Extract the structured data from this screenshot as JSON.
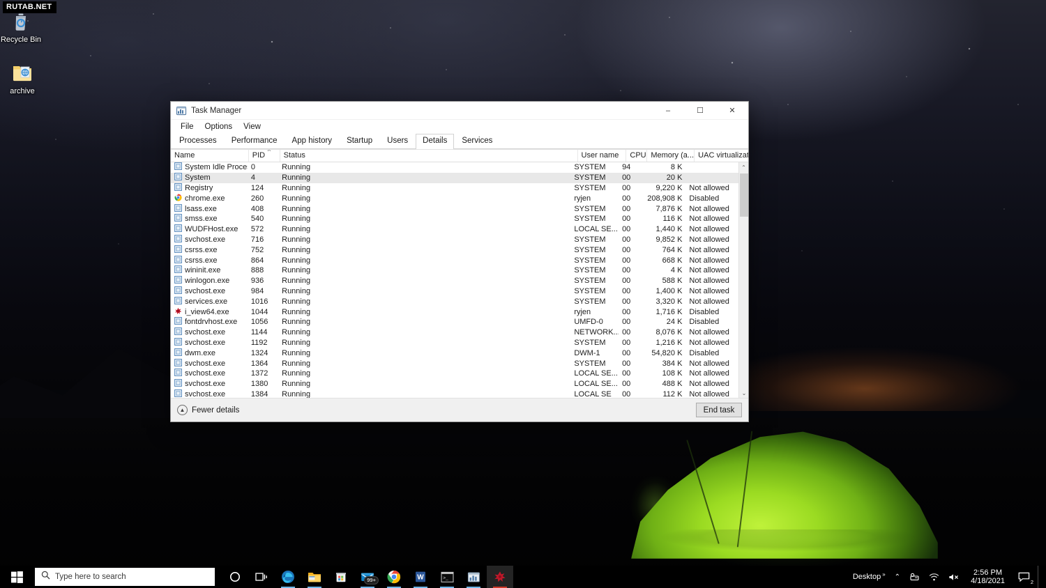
{
  "desktop": {
    "watermark": "RUTAB.NET",
    "icons": [
      {
        "label": "Recycle Bin",
        "icon": "recycle-bin-icon"
      },
      {
        "label": "archive",
        "icon": "folder-icon"
      }
    ]
  },
  "window": {
    "title": "Task Manager",
    "icon": "task-manager-icon",
    "controls": {
      "minimize": "‒",
      "maximize": "☐",
      "close": "✕"
    },
    "menu": [
      "File",
      "Options",
      "View"
    ],
    "tabs": [
      {
        "label": "Processes",
        "active": false
      },
      {
        "label": "Performance",
        "active": false
      },
      {
        "label": "App history",
        "active": false
      },
      {
        "label": "Startup",
        "active": false
      },
      {
        "label": "Users",
        "active": false
      },
      {
        "label": "Details",
        "active": true
      },
      {
        "label": "Services",
        "active": false
      }
    ],
    "columns": {
      "name": "Name",
      "pid": "PID",
      "status": "Status",
      "user": "User name",
      "cpu": "CPU",
      "memory": "Memory (a...",
      "uac": "UAC virtualizat...",
      "sort_indicator": "^"
    },
    "rows": [
      {
        "name": "System Idle Process",
        "pid": "0",
        "status": "Running",
        "user": "SYSTEM",
        "cpu": "94",
        "memory": "8 K",
        "uac": "",
        "icon": "process-icon",
        "selected": false
      },
      {
        "name": "System",
        "pid": "4",
        "status": "Running",
        "user": "SYSTEM",
        "cpu": "00",
        "memory": "20 K",
        "uac": "",
        "icon": "process-icon",
        "selected": true
      },
      {
        "name": "Registry",
        "pid": "124",
        "status": "Running",
        "user": "SYSTEM",
        "cpu": "00",
        "memory": "9,220 K",
        "uac": "Not allowed",
        "icon": "process-icon",
        "selected": false
      },
      {
        "name": "chrome.exe",
        "pid": "260",
        "status": "Running",
        "user": "ryjen",
        "cpu": "00",
        "memory": "208,908 K",
        "uac": "Disabled",
        "icon": "chrome-icon",
        "selected": false
      },
      {
        "name": "lsass.exe",
        "pid": "408",
        "status": "Running",
        "user": "SYSTEM",
        "cpu": "00",
        "memory": "7,876 K",
        "uac": "Not allowed",
        "icon": "process-icon",
        "selected": false
      },
      {
        "name": "smss.exe",
        "pid": "540",
        "status": "Running",
        "user": "SYSTEM",
        "cpu": "00",
        "memory": "116 K",
        "uac": "Not allowed",
        "icon": "process-icon",
        "selected": false
      },
      {
        "name": "WUDFHost.exe",
        "pid": "572",
        "status": "Running",
        "user": "LOCAL SE...",
        "cpu": "00",
        "memory": "1,440 K",
        "uac": "Not allowed",
        "icon": "process-icon",
        "selected": false
      },
      {
        "name": "svchost.exe",
        "pid": "716",
        "status": "Running",
        "user": "SYSTEM",
        "cpu": "00",
        "memory": "9,852 K",
        "uac": "Not allowed",
        "icon": "process-icon",
        "selected": false
      },
      {
        "name": "csrss.exe",
        "pid": "752",
        "status": "Running",
        "user": "SYSTEM",
        "cpu": "00",
        "memory": "764 K",
        "uac": "Not allowed",
        "icon": "process-icon",
        "selected": false
      },
      {
        "name": "csrss.exe",
        "pid": "864",
        "status": "Running",
        "user": "SYSTEM",
        "cpu": "00",
        "memory": "668 K",
        "uac": "Not allowed",
        "icon": "process-icon",
        "selected": false
      },
      {
        "name": "wininit.exe",
        "pid": "888",
        "status": "Running",
        "user": "SYSTEM",
        "cpu": "00",
        "memory": "4 K",
        "uac": "Not allowed",
        "icon": "process-icon",
        "selected": false
      },
      {
        "name": "winlogon.exe",
        "pid": "936",
        "status": "Running",
        "user": "SYSTEM",
        "cpu": "00",
        "memory": "588 K",
        "uac": "Not allowed",
        "icon": "process-icon",
        "selected": false
      },
      {
        "name": "svchost.exe",
        "pid": "984",
        "status": "Running",
        "user": "SYSTEM",
        "cpu": "00",
        "memory": "1,400 K",
        "uac": "Not allowed",
        "icon": "process-icon",
        "selected": false
      },
      {
        "name": "services.exe",
        "pid": "1016",
        "status": "Running",
        "user": "SYSTEM",
        "cpu": "00",
        "memory": "3,320 K",
        "uac": "Not allowed",
        "icon": "process-icon",
        "selected": false
      },
      {
        "name": "i_view64.exe",
        "pid": "1044",
        "status": "Running",
        "user": "ryjen",
        "cpu": "00",
        "memory": "1,716 K",
        "uac": "Disabled",
        "icon": "irfanview-icon",
        "selected": false
      },
      {
        "name": "fontdrvhost.exe",
        "pid": "1056",
        "status": "Running",
        "user": "UMFD-0",
        "cpu": "00",
        "memory": "24 K",
        "uac": "Disabled",
        "icon": "process-icon",
        "selected": false
      },
      {
        "name": "svchost.exe",
        "pid": "1144",
        "status": "Running",
        "user": "NETWORK...",
        "cpu": "00",
        "memory": "8,076 K",
        "uac": "Not allowed",
        "icon": "process-icon",
        "selected": false
      },
      {
        "name": "svchost.exe",
        "pid": "1192",
        "status": "Running",
        "user": "SYSTEM",
        "cpu": "00",
        "memory": "1,216 K",
        "uac": "Not allowed",
        "icon": "process-icon",
        "selected": false
      },
      {
        "name": "dwm.exe",
        "pid": "1324",
        "status": "Running",
        "user": "DWM-1",
        "cpu": "00",
        "memory": "54,820 K",
        "uac": "Disabled",
        "icon": "process-icon",
        "selected": false
      },
      {
        "name": "svchost.exe",
        "pid": "1364",
        "status": "Running",
        "user": "SYSTEM",
        "cpu": "00",
        "memory": "384 K",
        "uac": "Not allowed",
        "icon": "process-icon",
        "selected": false
      },
      {
        "name": "svchost.exe",
        "pid": "1372",
        "status": "Running",
        "user": "LOCAL SE...",
        "cpu": "00",
        "memory": "108 K",
        "uac": "Not allowed",
        "icon": "process-icon",
        "selected": false
      },
      {
        "name": "svchost.exe",
        "pid": "1380",
        "status": "Running",
        "user": "LOCAL SE...",
        "cpu": "00",
        "memory": "488 K",
        "uac": "Not allowed",
        "icon": "process-icon",
        "selected": false
      },
      {
        "name": "svchost.exe",
        "pid": "1384",
        "status": "Running",
        "user": "LOCAL SE",
        "cpu": "00",
        "memory": "112 K",
        "uac": "Not allowed",
        "icon": "process-icon",
        "selected": false
      }
    ],
    "footer": {
      "fewer_details": "Fewer details",
      "end_task": "End task"
    },
    "scrollbar": {
      "up": "⌃",
      "down": "⌄"
    }
  },
  "taskbar": {
    "start_icon": "windows-start-icon",
    "search": {
      "placeholder": "Type here to search",
      "icon": "search-icon"
    },
    "items": [
      {
        "name": "cortana-icon",
        "active": false,
        "running": false,
        "badge": ""
      },
      {
        "name": "task-view-icon",
        "active": false,
        "running": false,
        "badge": ""
      },
      {
        "name": "edge-icon",
        "active": false,
        "running": true,
        "badge": ""
      },
      {
        "name": "file-explorer-icon",
        "active": false,
        "running": true,
        "badge": ""
      },
      {
        "name": "microsoft-store-icon",
        "active": false,
        "running": false,
        "badge": ""
      },
      {
        "name": "mail-icon",
        "active": false,
        "running": true,
        "badge": "99+"
      },
      {
        "name": "chrome-icon",
        "active": false,
        "running": true,
        "badge": ""
      },
      {
        "name": "word-icon",
        "active": false,
        "running": true,
        "badge": ""
      },
      {
        "name": "terminal-icon",
        "active": false,
        "running": true,
        "badge": ""
      },
      {
        "name": "task-manager-icon",
        "active": false,
        "running": true,
        "badge": ""
      },
      {
        "name": "irfanview-icon",
        "active": true,
        "running": true,
        "badge": ""
      }
    ],
    "tray": {
      "desktop_label": "Desktop",
      "overflow": "»",
      "chevron": "⌃",
      "items": [
        "network-tray-icon",
        "wifi-icon",
        "volume-muted-icon"
      ],
      "time": "2:56 PM",
      "date": "4/18/2021",
      "notification_count": "2"
    }
  }
}
